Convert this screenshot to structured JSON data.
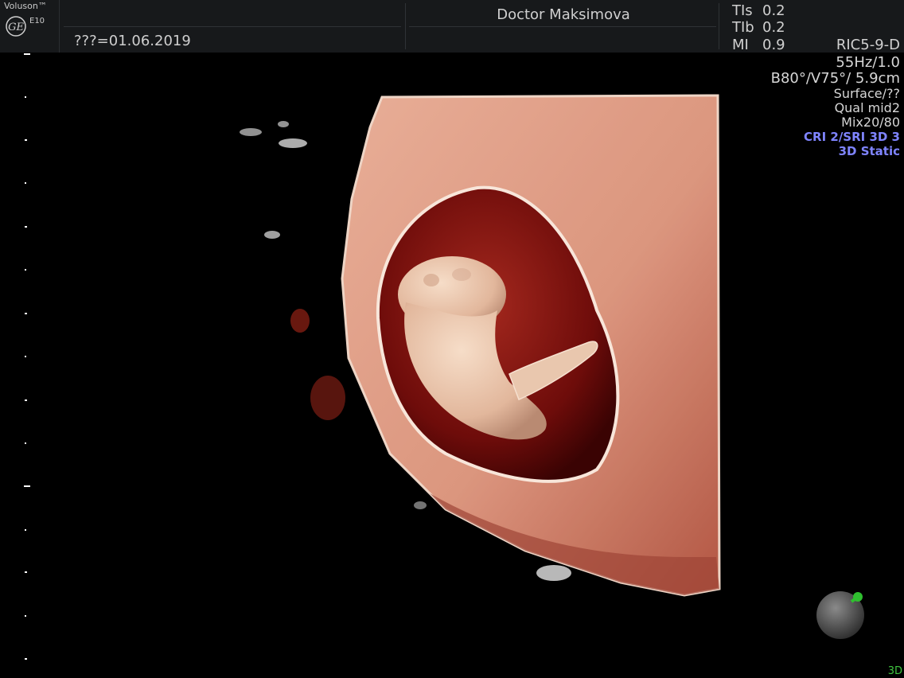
{
  "header": {
    "brand": "Voluson™",
    "model": "E10",
    "date_label": "???=01.06.2019",
    "doctor": "Doctor Maksimova"
  },
  "indices": [
    {
      "label": "TIs",
      "value": "0.2"
    },
    {
      "label": "TIb",
      "value": "0.2"
    },
    {
      "label": "MI",
      "value": "0.9"
    }
  ],
  "probe": "RIC5-9-D",
  "params": [
    {
      "text": "55Hz/1.0",
      "style": "big"
    },
    {
      "text": "B80°/V75°/ 5.9cm",
      "style": "big"
    },
    {
      "text": "Surface/??",
      "style": "normal"
    },
    {
      "text": "Qual mid2",
      "style": "normal"
    },
    {
      "text": "Mix20/80",
      "style": "normal"
    },
    {
      "text": "CRI 2/SRI 3D 3",
      "style": "blue"
    },
    {
      "text": "3D Static",
      "style": "blue"
    }
  ],
  "mode_label": "3D",
  "colors": {
    "tissue": "#e6a28a",
    "gestational_sac": "#7a1010",
    "embryo": "#e8c2a8",
    "params_blue": "#7f84ff",
    "scale_marks": "#ffffff",
    "orientation_marker": "#2fbf2f"
  },
  "icons": {
    "logo": "ge-logo-icon",
    "orientation": "orientation-sphere-icon"
  }
}
